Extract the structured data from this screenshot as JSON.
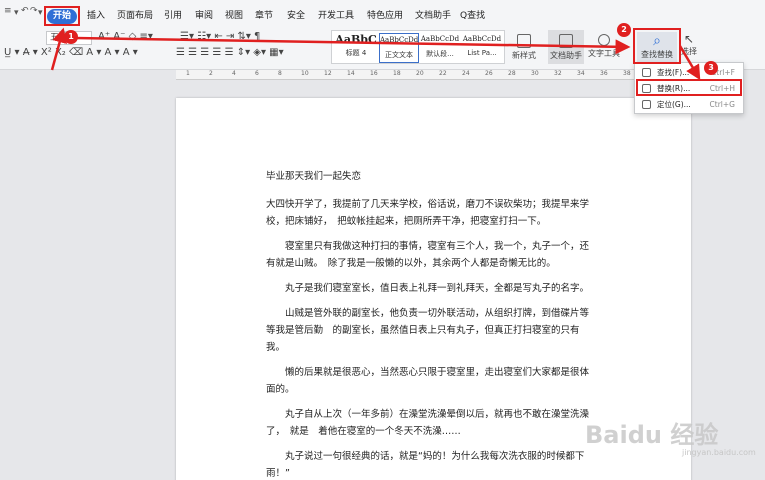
{
  "menu": {
    "quick": [
      "≡",
      "▾",
      "↶",
      "↷",
      "▾"
    ],
    "start": "开始",
    "tabs": [
      "插入",
      "页面布局",
      "引用",
      "审阅",
      "视图",
      "章节",
      "安全",
      "开发工具",
      "特色应用",
      "文档助手"
    ],
    "search": "Q查找"
  },
  "ribbon": {
    "row1_font": "五号",
    "styles": [
      {
        "preview": "AaBbC",
        "label": "标题 4"
      },
      {
        "preview": "AaBbCcDd",
        "label": "正文文本"
      },
      {
        "preview": "AaBbCcDd",
        "label": "默认段..."
      },
      {
        "preview": "AaBbCcDd",
        "label": "List Pa..."
      }
    ],
    "new_style": "新样式",
    "doc_helper": "文档助手",
    "text_tools": "文字工具",
    "find_replace": "查找替换",
    "select": "选择"
  },
  "dropdown": {
    "items": [
      {
        "label": "查找(F)...",
        "shortcut": "Ctrl+F"
      },
      {
        "label": "替换(R)...",
        "shortcut": "Ctrl+H"
      },
      {
        "label": "定位(G)...",
        "shortcut": "Ctrl+G"
      }
    ]
  },
  "ruler": [
    "1",
    "2",
    "4",
    "6",
    "8",
    "10",
    "12",
    "14",
    "16",
    "18",
    "20",
    "22",
    "24",
    "26",
    "28",
    "30",
    "32",
    "34",
    "36",
    "38",
    "40",
    "42"
  ],
  "document": {
    "title": "毕业那天我们一起失恋",
    "paragraphs": [
      "大四快开学了，我提前了几天来学校，俗话说，磨刀不误砍柴功；我提早来学校，把床铺好，　把蚊帐挂起来，把厕所弄干净，把寝室打扫一下。",
      "　　寝室里只有我做这种打扫的事情，寝室有三个人，我一个，丸子一个，还有就是山贼。　除了我是一般懒的以外，其余两个人都是奇懒无比的。",
      "　　丸子是我们寝室室长，值日表上礼拜一到礼拜天，全都是写丸子的名字。",
      "　　山贼是管外联的副室长，他负责一切外联活动，从组织打牌，到借碟片等等我是管后勤　的副室长，虽然值日表上只有丸子，但真正打扫寝室的只有我。",
      "　　懒的后果就是很恶心，当然恶心只限于寝室里，走出寝室们大家都是很体面的。",
      "　　丸子自从上次（一年多前）在澡堂洗澡晕倒以后，就再也不敢在澡堂洗澡了，　就是　着他在寝室的一个冬天不洗澡……",
      "　　丸子说过一句很经典的话，就是“妈的！为什么我每次洗衣服的时候都下雨！”"
    ]
  },
  "badges": [
    "1",
    "2",
    "3"
  ],
  "watermark": {
    "main": "Baidu 经验",
    "sub": "jingyan.baidu.com"
  }
}
